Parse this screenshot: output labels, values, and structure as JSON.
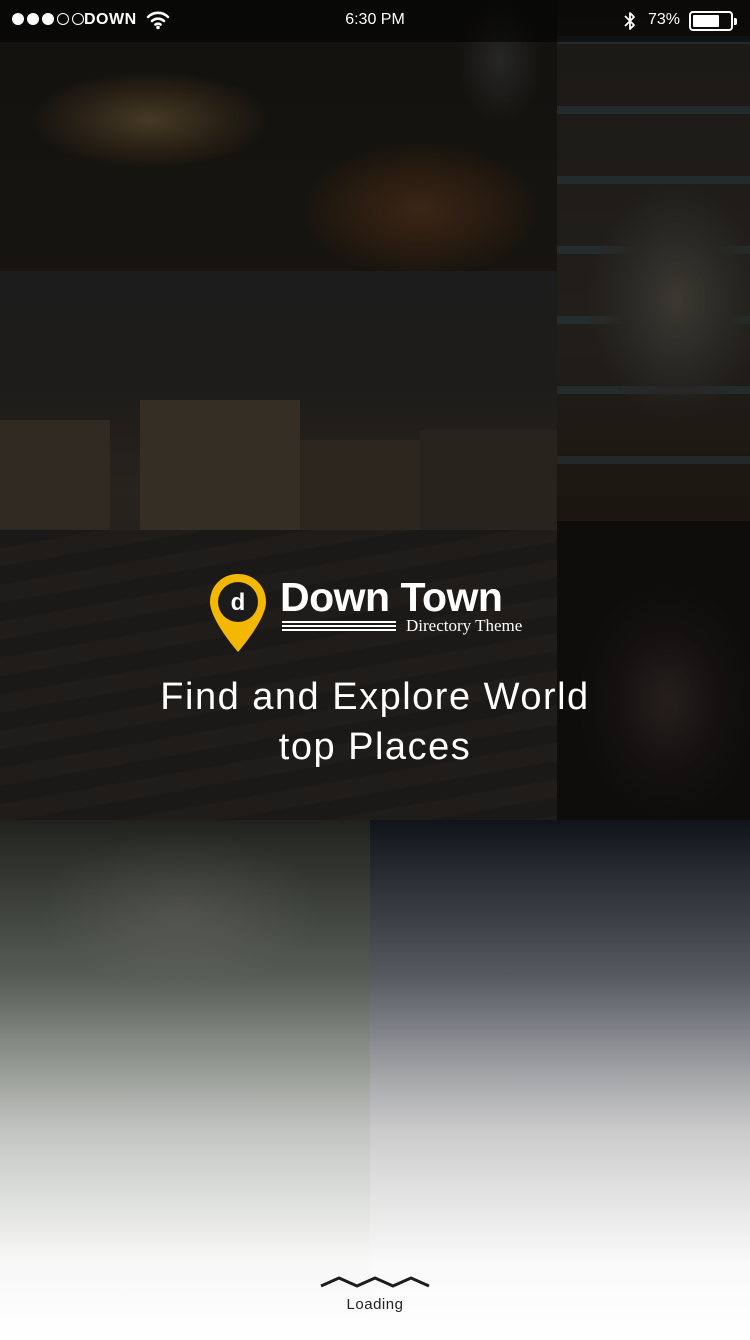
{
  "status_bar": {
    "carrier": "DOWN",
    "time": "6:30 PM",
    "battery_percent": "73%",
    "battery_level": 0.73,
    "signal_filled": 3,
    "signal_total": 5
  },
  "brand": {
    "logo_letter": "d",
    "name": "Down Town",
    "subtitle": "Directory Theme",
    "accent_color": "#F5B800"
  },
  "tagline": {
    "line1": "Find and Explore World",
    "line2": "top Places"
  },
  "loading": {
    "label": "Loading",
    "icon": "wave-icon"
  },
  "background": {
    "tiles": [
      "food-photo",
      "drink-photo",
      "city-square-photo",
      "dark-photo",
      "forest-photo",
      "town-photo"
    ]
  }
}
